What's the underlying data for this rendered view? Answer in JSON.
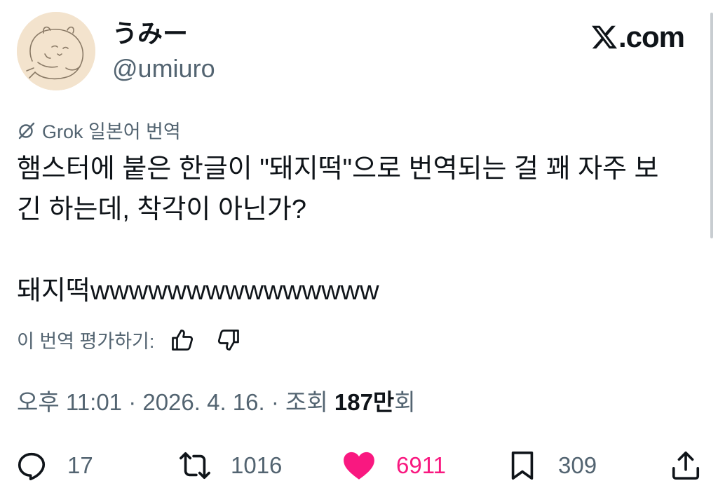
{
  "author": {
    "display_name": "うみー",
    "handle": "@umiuro"
  },
  "brand": {
    "label": ".com"
  },
  "translation": {
    "label": "Grok 일본어 번역"
  },
  "tweet": {
    "text": "햄스터에 붙은 한글이 \"돼지떡\"으로 번역되는 걸 꽤 자주 보\n긴 하는데, 착각이 아닌가?\n\n돼지떡wwwwwwwwwwwwwww"
  },
  "rating": {
    "label": "이 번역 평가하기:"
  },
  "meta": {
    "time_date": "오후 11:01 · 2026. 4. 16. · 조회 ",
    "views_number": "187만",
    "views_suffix": "회"
  },
  "actions": {
    "replies": "17",
    "reposts": "1016",
    "likes": "6911",
    "bookmarks": "309"
  },
  "colors": {
    "text": "#0f1419",
    "secondary": "#536471",
    "like": "#f91880"
  },
  "icons": [
    "grok-icon",
    "thumbs-up-icon",
    "thumbs-down-icon",
    "reply-icon",
    "repost-icon",
    "heart-icon",
    "bookmark-icon",
    "share-icon",
    "x-logo-icon"
  ]
}
